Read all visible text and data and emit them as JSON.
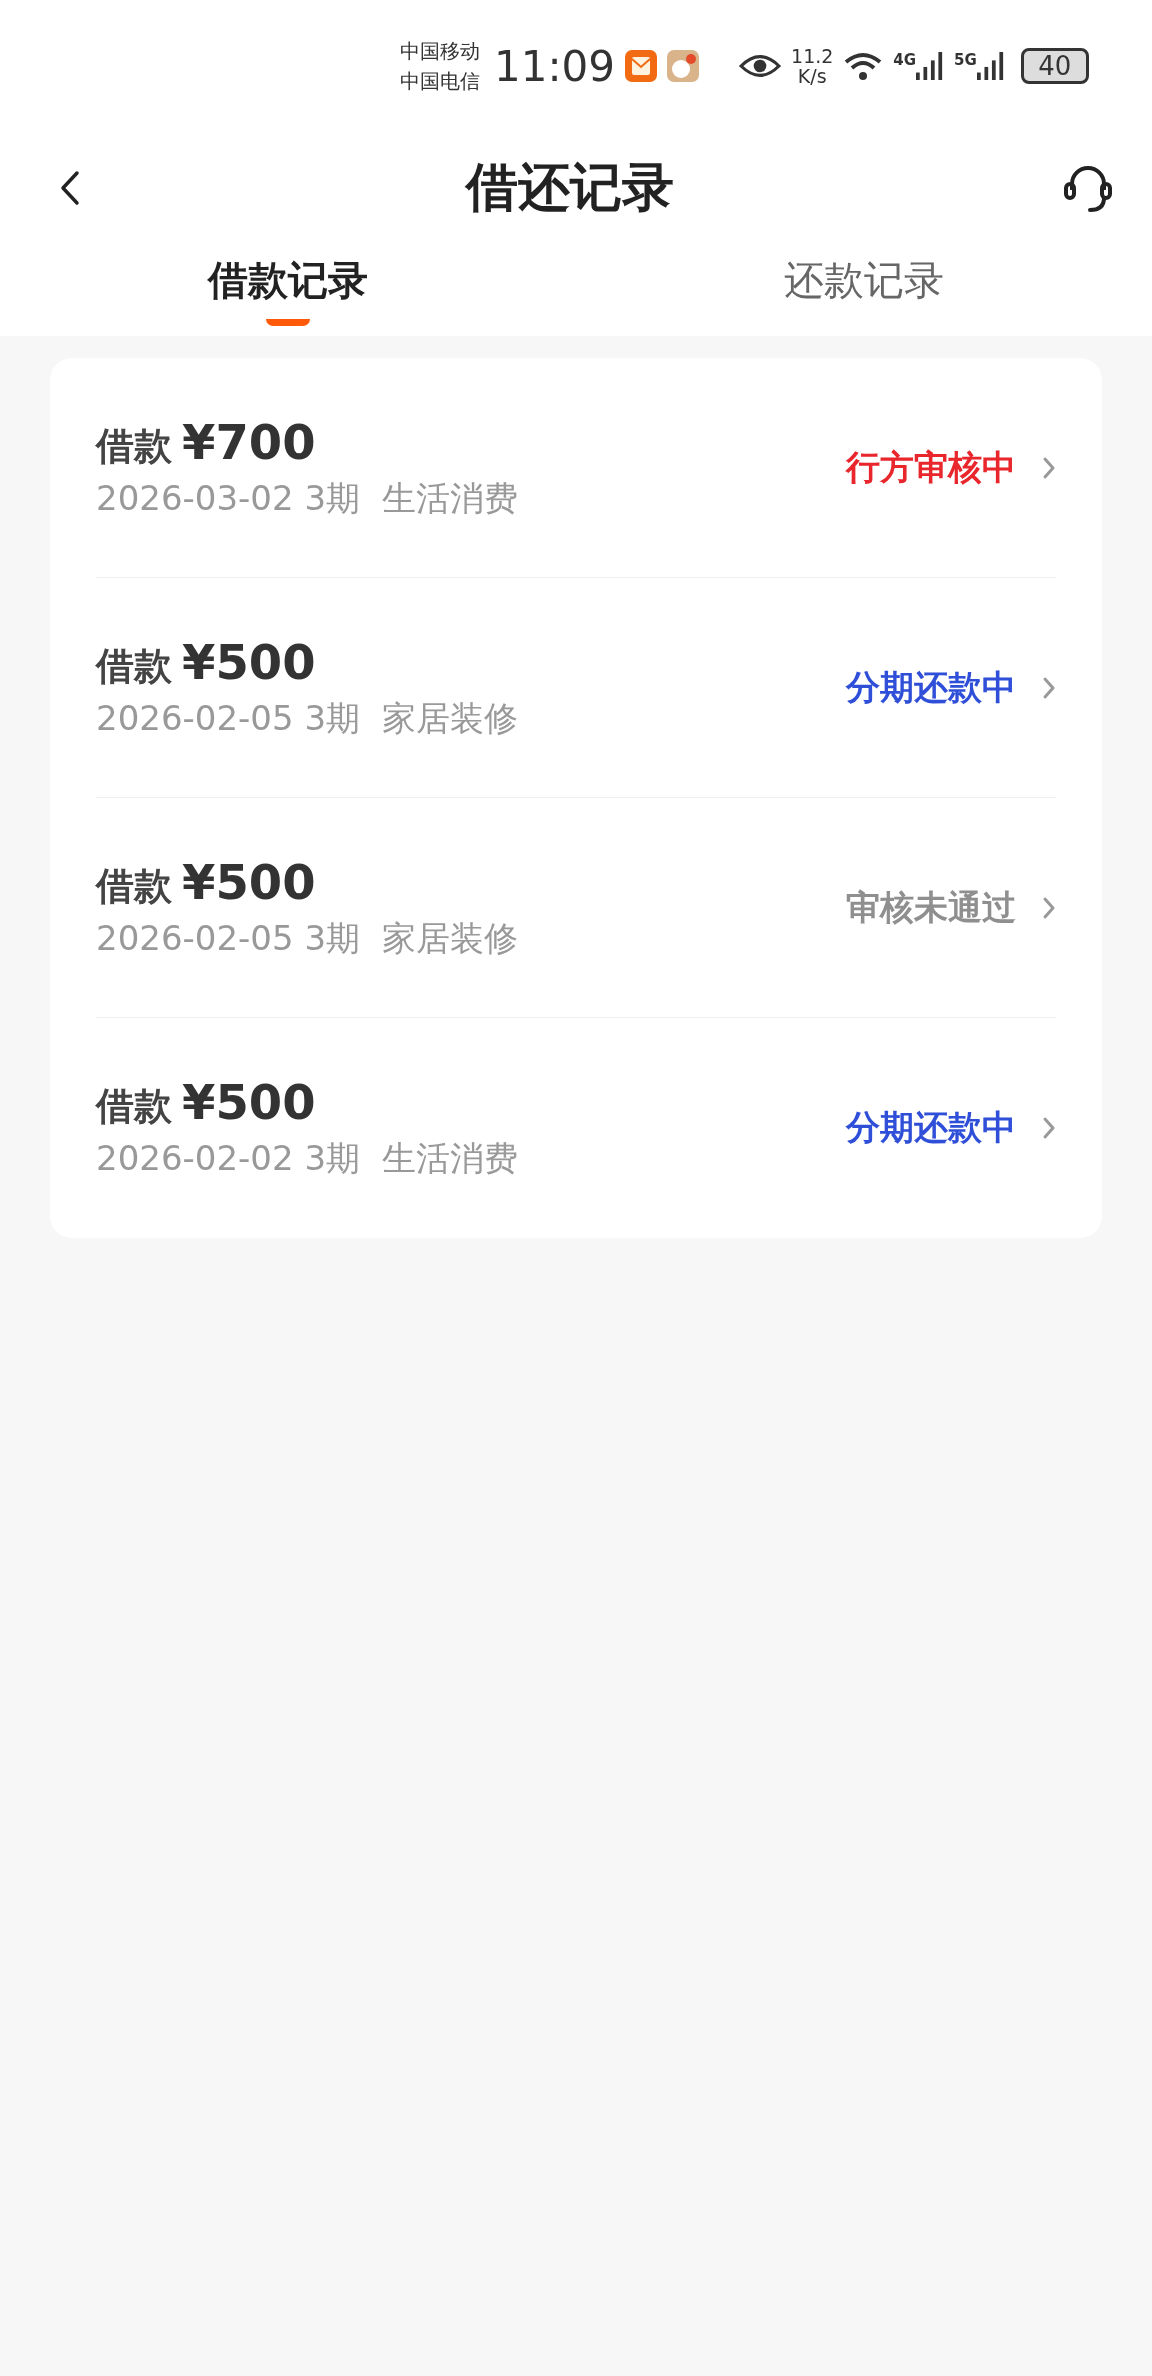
{
  "status_bar": {
    "carriers": [
      "中国移动",
      "中国电信"
    ],
    "time": "11:09",
    "speed_value": "11.2",
    "speed_unit": "K/s",
    "networks": [
      "4G",
      "5G"
    ],
    "battery": "40"
  },
  "header": {
    "title": "借还记录"
  },
  "tabs": [
    {
      "label": "借款记录",
      "selected": true
    },
    {
      "label": "还款记录",
      "selected": false
    }
  ],
  "loans": [
    {
      "label": "借款",
      "amount": "¥700",
      "date_term": "2026-03-02 3期",
      "purpose": "生活消费",
      "status": "行方审核中",
      "color": "#e8262b"
    },
    {
      "label": "借款",
      "amount": "¥500",
      "date_term": "2026-02-05 3期",
      "purpose": "家居装修",
      "status": "分期还款中",
      "color": "#2f4fd8"
    },
    {
      "label": "借款",
      "amount": "¥500",
      "date_term": "2026-02-05 3期",
      "purpose": "家居装修",
      "status": "审核未通过",
      "color": "#8f8f8f"
    },
    {
      "label": "借款",
      "amount": "¥500",
      "date_term": "2026-02-02 3期",
      "purpose": "生活消费",
      "status": "分期还款中",
      "color": "#2f4fd8"
    }
  ]
}
